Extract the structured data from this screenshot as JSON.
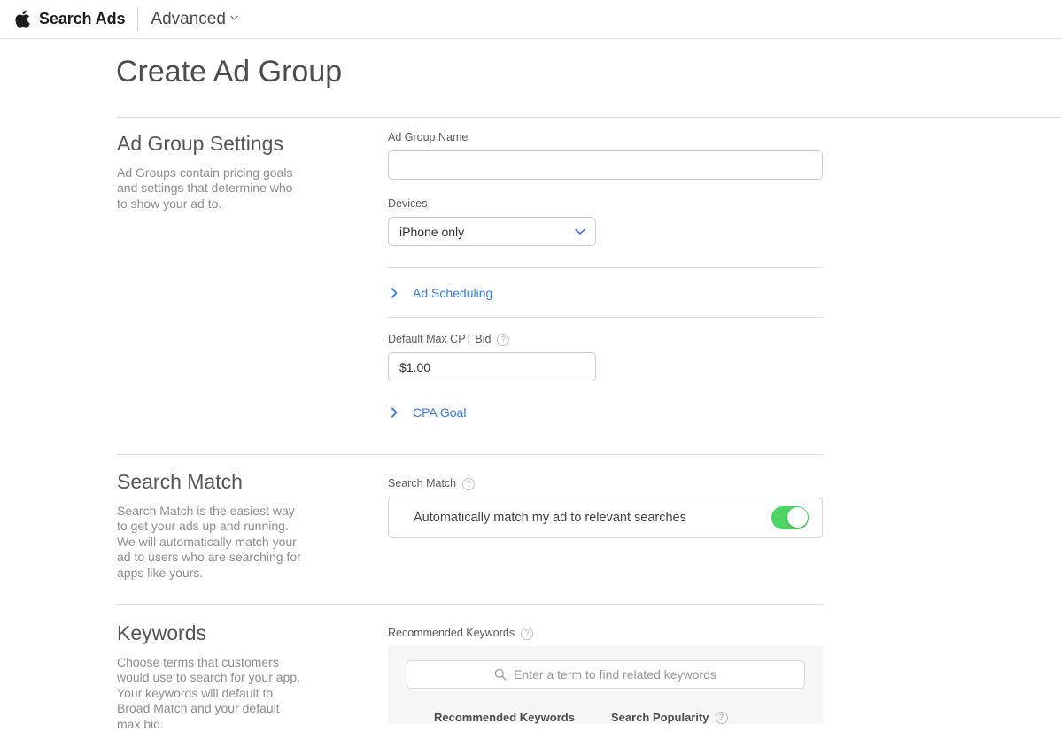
{
  "topbar": {
    "apple_logo_icon": "apple-logo-icon",
    "brand": "Search Ads",
    "account_menu": "Advanced",
    "account_menu_chevron_icon": "chevron-down-icon"
  },
  "page": {
    "title": "Create Ad Group"
  },
  "sections": [
    {
      "id": "ad-group-settings",
      "heading": "Ad Group Settings",
      "description": "Ad Groups contain pricing goals and settings that determine who to show your ad to.",
      "fields": {
        "ad_group_name": {
          "label": "Ad Group Name",
          "value": "",
          "placeholder": ""
        },
        "devices": {
          "label": "Devices",
          "value": "iPhone only",
          "chevron_icon": "chevron-down-icon"
        },
        "ad_scheduling": {
          "label": "Ad Scheduling",
          "arrow_icon": "chevron-right-icon"
        },
        "default_max_cpt_bid": {
          "label": "Default Max CPT Bid",
          "help_icon": "help-question-icon",
          "help_glyph": "?",
          "value": "$1.00"
        },
        "cpa_goal": {
          "label": "CPA Goal",
          "arrow_icon": "chevron-right-icon"
        }
      }
    },
    {
      "id": "search-match",
      "heading": "Search Match",
      "description": "Search Match is the easiest way to get your ads up and running. We will automatically match your ad to users who are searching for apps like yours.",
      "fields": {
        "search_match": {
          "label": "Search Match",
          "help_icon": "help-question-icon",
          "help_glyph": "?",
          "toggle_text": "Automatically match my ad to relevant searches",
          "toggle_state": "on"
        }
      }
    },
    {
      "id": "keywords",
      "heading": "Keywords",
      "description": "Choose terms that customers would use to search for your app. Your keywords will default to Broad Match and your default max bid.",
      "fields": {
        "recommended_keywords": {
          "label": "Recommended Keywords",
          "help_icon": "help-question-icon",
          "help_glyph": "?",
          "search_icon": "search-icon",
          "search_placeholder": "Enter a term to find related keywords",
          "search_value": "",
          "table_headers": {
            "keyword": "Recommended Keywords",
            "popularity": "Search Popularity",
            "popularity_help_icon": "help-question-icon",
            "popularity_help_glyph": "?"
          }
        }
      }
    }
  ],
  "colors": {
    "link_blue": "#3478f6",
    "toggle_green": "#4cd663",
    "panel_gray": "#f6f6f6",
    "rule_gray": "#dcdcdc"
  }
}
